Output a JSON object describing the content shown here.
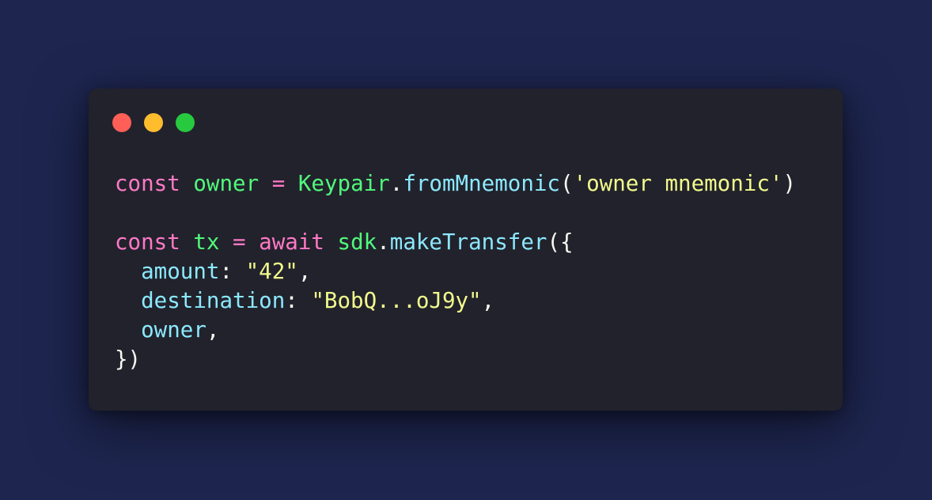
{
  "colors": {
    "background": "#1e2650",
    "window": "#22222c",
    "close": "#ff5f56",
    "minimize": "#ffbd2e",
    "maximize": "#27c93f",
    "keyword": "#ff79c6",
    "variable": "#50fa7b",
    "function": "#8be9fd",
    "string": "#f1fa8c",
    "punctuation": "#f8f8f2"
  },
  "window_controls": {
    "close_icon": "red-circle",
    "minimize_icon": "yellow-circle",
    "maximize_icon": "green-circle"
  },
  "code": {
    "line1": {
      "kw": "const",
      "var": "owner",
      "op": "=",
      "cls": "Keypair",
      "dot": ".",
      "fn": "fromMnemonic",
      "open": "(",
      "str": "'owner mnemonic'",
      "close": ")"
    },
    "line2": {
      "kw": "const",
      "var": "tx",
      "op": "=",
      "kw2": "await",
      "obj": "sdk",
      "dot": ".",
      "fn": "makeTransfer",
      "open": "({"
    },
    "line3": {
      "prop": "amount",
      "colon": ":",
      "str": "\"42\"",
      "comma": ","
    },
    "line4": {
      "prop": "destination",
      "colon": ":",
      "str": "\"BobQ...oJ9y\"",
      "comma": ","
    },
    "line5": {
      "prop": "owner",
      "comma": ","
    },
    "line6": {
      "close": "})"
    }
  }
}
